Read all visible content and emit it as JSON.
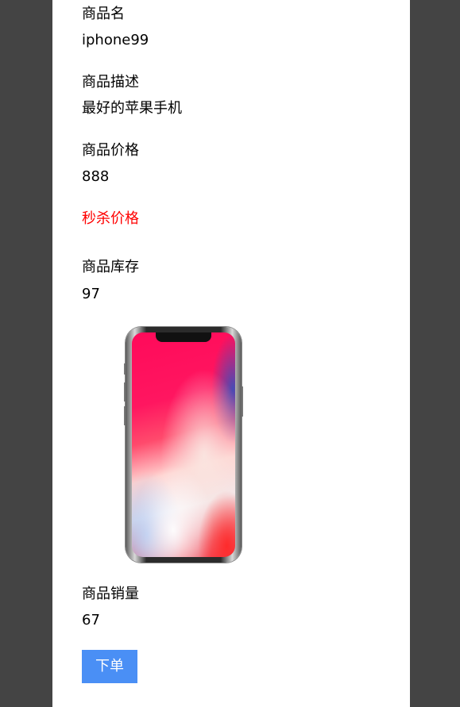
{
  "product": {
    "name_label": "商品名",
    "name_value": "iphone99",
    "desc_label": "商品描述",
    "desc_value": "最好的苹果手机",
    "price_label": "商品价格",
    "price_value": "888",
    "seckill_label": "秒杀价格",
    "stock_label": "商品库存",
    "stock_value": "97",
    "sales_label": "商品销量",
    "sales_value": "67",
    "image_alt": "iPhone X"
  },
  "actions": {
    "order_label": "下单"
  },
  "colors": {
    "page_background": "#444444",
    "panel_background": "#ffffff",
    "seckill_text": "#ff0000",
    "order_button": "#4a8ff5"
  }
}
